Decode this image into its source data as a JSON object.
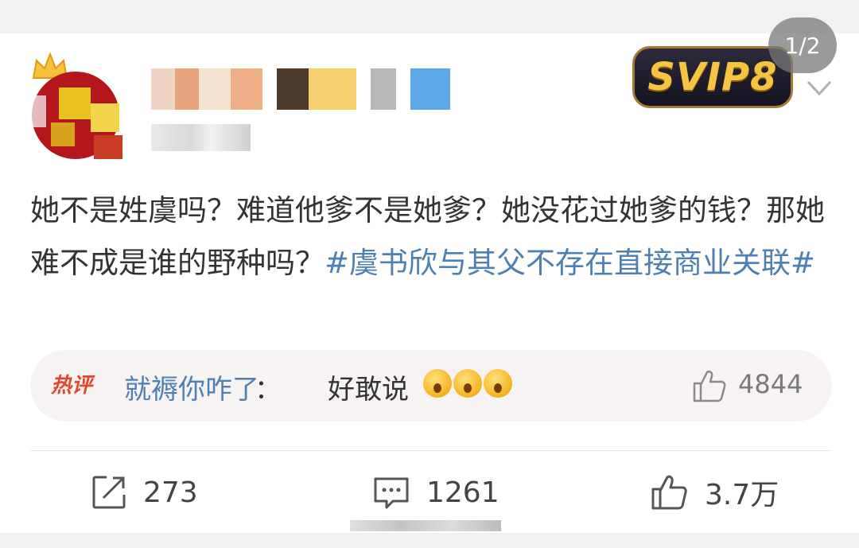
{
  "page_indicator": "1/2",
  "badge": {
    "text": "SVIP8",
    "color": "#f5c542"
  },
  "post": {
    "text": "她不是姓虞吗？难道他爹不是她爹？她没花过她爹的钱？那她难不成是谁的野种吗？",
    "hashtag": "#虞书欣与其父不存在直接商业关联#"
  },
  "hot_comment": {
    "badge": "热评",
    "user": "就褥你咋了",
    "separator": "：",
    "text": "好敢说",
    "emoji": [
      "face-with-hand-over-mouth-emoji",
      "face-with-hand-over-mouth-emoji",
      "face-with-hand-over-mouth-emoji"
    ],
    "likes": "4844"
  },
  "actions": {
    "repost": "273",
    "comments": "1261",
    "likes": "3.7万"
  },
  "colors": {
    "link": "#4e7fb3",
    "hot_badge": "#e0472d",
    "text": "#333333"
  }
}
